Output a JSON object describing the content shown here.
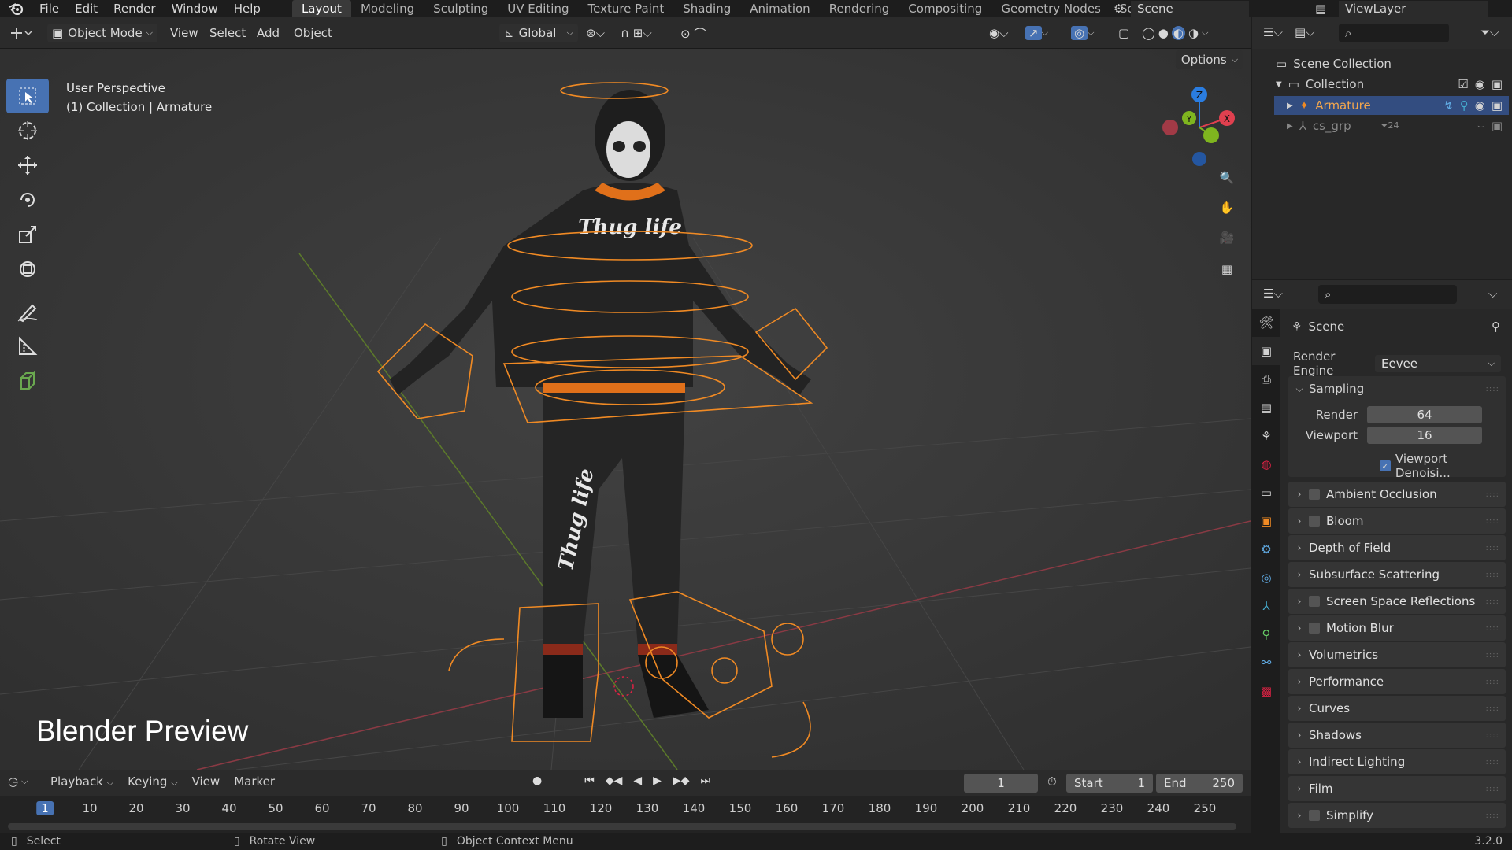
{
  "topbar": {
    "menus": [
      "File",
      "Edit",
      "Render",
      "Window",
      "Help"
    ],
    "workspaces": [
      "Layout",
      "Modeling",
      "Sculpting",
      "UV Editing",
      "Texture Paint",
      "Shading",
      "Animation",
      "Rendering",
      "Compositing",
      "Geometry Nodes",
      "Scripting"
    ],
    "active_workspace": "Layout",
    "scene": "Scene",
    "view_layer": "ViewLayer"
  },
  "viewport_header": {
    "mode": "Object Mode",
    "menus": [
      "View",
      "Select",
      "Add",
      "Object"
    ],
    "orientation": "Global",
    "options": "Options"
  },
  "viewport": {
    "perspective": "User Perspective",
    "context": "(1) Collection | Armature",
    "overlay_text": "Blender Preview",
    "character_text": "Thug life",
    "gizmo_axes": [
      "Z",
      "Y",
      "X"
    ]
  },
  "timeline": {
    "menus": [
      "Playback",
      "Keying",
      "View",
      "Marker"
    ],
    "current_frame": "1",
    "start_label": "Start",
    "start": "1",
    "end_label": "End",
    "end": "250",
    "frame_marks": [
      "1",
      "10",
      "20",
      "30",
      "40",
      "50",
      "60",
      "70",
      "80",
      "90",
      "100",
      "110",
      "120",
      "130",
      "140",
      "150",
      "160",
      "170",
      "180",
      "190",
      "200",
      "210",
      "220",
      "230",
      "240",
      "250"
    ]
  },
  "statusbar": {
    "select": "Select",
    "rotate": "Rotate View",
    "context_menu": "Object Context Menu",
    "version": "3.2.0"
  },
  "outliner": {
    "scene_collection": "Scene Collection",
    "collection": "Collection",
    "items": [
      {
        "name": "Armature",
        "selected": true
      },
      {
        "name": "cs_grp",
        "badge": "24",
        "selected": false
      }
    ]
  },
  "properties": {
    "context": "Scene",
    "render_engine_label": "Render Engine",
    "render_engine": "Eevee",
    "sampling": {
      "title": "Sampling",
      "render_label": "Render",
      "render": "64",
      "viewport_label": "Viewport",
      "viewport": "16",
      "denoise_label": "Viewport Denoisi..."
    },
    "panels": [
      {
        "label": "Ambient Occlusion",
        "checkbox": true
      },
      {
        "label": "Bloom",
        "checkbox": true
      },
      {
        "label": "Depth of Field",
        "checkbox": false
      },
      {
        "label": "Subsurface Scattering",
        "checkbox": false
      },
      {
        "label": "Screen Space Reflections",
        "checkbox": true
      },
      {
        "label": "Motion Blur",
        "checkbox": true
      },
      {
        "label": "Volumetrics",
        "checkbox": false
      },
      {
        "label": "Performance",
        "checkbox": false
      },
      {
        "label": "Curves",
        "checkbox": false
      },
      {
        "label": "Shadows",
        "checkbox": false
      },
      {
        "label": "Indirect Lighting",
        "checkbox": false
      },
      {
        "label": "Film",
        "checkbox": false
      },
      {
        "label": "Simplify",
        "checkbox": true
      }
    ]
  },
  "colors": {
    "accent": "#4772b3",
    "armature": "#f08a24",
    "axis_x": "#e0404f",
    "axis_y": "#7fb51f",
    "axis_z": "#2a7de1"
  }
}
